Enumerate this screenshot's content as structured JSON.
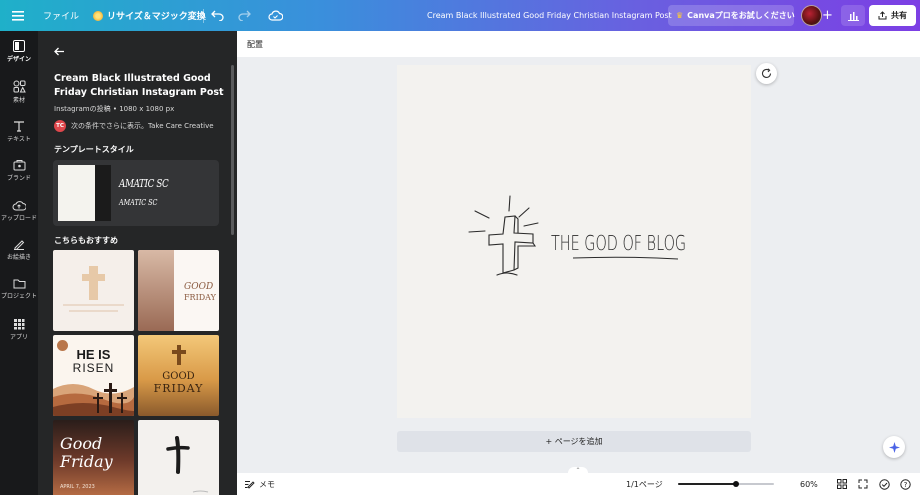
{
  "topbar": {
    "menu_icon": "hamburger-menu-icon",
    "file_label": "ファイル",
    "resize_label": "リサイズ＆マジック変換",
    "doc_title": "Cream Black Illustrated Good Friday Christian Instagram Post",
    "trial_label": "Canvaプロをお試しください",
    "share_label": "共有"
  },
  "rail": {
    "items": [
      {
        "label": "デザイン",
        "icon": "layout-icon"
      },
      {
        "label": "素材",
        "icon": "elements-icon"
      },
      {
        "label": "テキスト",
        "icon": "text-icon"
      },
      {
        "label": "ブランド",
        "icon": "brand-icon"
      },
      {
        "label": "アップロード",
        "icon": "upload-icon"
      },
      {
        "label": "お絵描き",
        "icon": "draw-icon"
      },
      {
        "label": "プロジェクト",
        "icon": "folder-icon"
      },
      {
        "label": "アプリ",
        "icon": "apps-icon"
      }
    ]
  },
  "panel": {
    "title": "Cream Black Illustrated Good Friday Christian Instagram Post",
    "meta": "Instagramの投稿 • 1080 x 1080 px",
    "author_initials": "TC",
    "author_text": "次の条件でさらに表示。Take Care Creative",
    "style_heading": "テンプレートスタイル",
    "font_sample_1": "AMATIC SC",
    "font_sample_2": "AMATIC SC",
    "recommend_heading": "こちらもおすすめ",
    "thumbs": {
      "t2_line1": "GOOD",
      "t2_line2": "FRIDAY",
      "t3_line1": "HE IS",
      "t3_line2": "RISEN",
      "t4_line1": "GOOD",
      "t4_line2": "FRIDAY",
      "t5_line1": "Good",
      "t5_line2": "Friday",
      "t5_date": "APRIL 7, 2023"
    }
  },
  "canvas": {
    "toolbar_label": "配置",
    "logo_text": "THE GOD OF BLOG",
    "add_page_label": "+ ページを追加"
  },
  "bottombar": {
    "notes_label": "メモ",
    "page_indicator": "1/1ページ",
    "zoom_label": "60%",
    "zoom_fraction": 0.6
  }
}
